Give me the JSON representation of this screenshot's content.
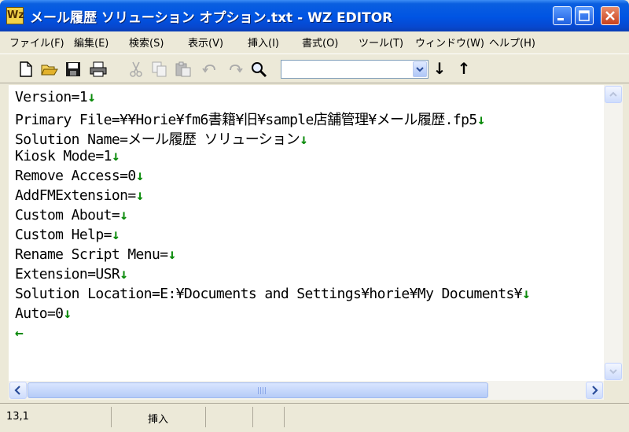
{
  "window": {
    "title": "メール履歴 ソリューション オプション.txt - WZ EDITOR",
    "icon_letter": "Wz"
  },
  "menu": [
    "ファイル(F)",
    "編集(E)",
    "検索(S)",
    "表示(V)",
    "挿入(I)",
    "書式(O)",
    "ツール(T)",
    "ウィンドウ(W)",
    "ヘルプ(H)"
  ],
  "toolbar": {
    "icons": [
      "new-file-icon",
      "open-folder-icon",
      "save-icon",
      "print-icon",
      "cut-icon",
      "copy-icon",
      "paste-icon",
      "undo-icon",
      "redo-icon",
      "find-icon"
    ],
    "search_value": "",
    "next_arrow": "↓",
    "prev_arrow": "↑"
  },
  "editor": {
    "eol_mark": "↓",
    "eof_mark": "←",
    "lines": [
      "Version=1",
      "Primary File=¥¥Horie¥fm6書籍¥旧¥sample店舗管理¥メール履歴.fp5",
      "Solution Name=メール履歴 ソリューション",
      "Kiosk Mode=1",
      "Remove Access=0",
      "AddFMExtension=",
      "Custom About=",
      "Custom Help=",
      "Rename Script Menu=",
      "Extension=USR",
      "Solution Location=E:¥Documents and Settings¥horie¥My Documents¥",
      "Auto=0"
    ]
  },
  "statusbar": {
    "position": "13,1",
    "mode": "挿入"
  },
  "colors": {
    "titlebar": "#0054e3",
    "eol_mark": "#0a8a0a"
  }
}
